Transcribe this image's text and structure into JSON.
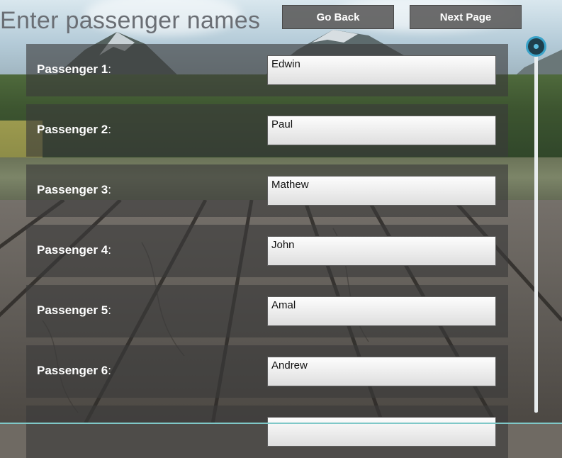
{
  "header": {
    "title": "Enter passenger names",
    "back_button": "Go Back",
    "next_button": "Next Page"
  },
  "passengers": [
    {
      "label": "Passenger 1",
      "value": "Edwin"
    },
    {
      "label": "Passenger 2",
      "value": "Paul"
    },
    {
      "label": "Passenger 3",
      "value": "Mathew"
    },
    {
      "label": "Passenger 4",
      "value": "John"
    },
    {
      "label": "Passenger 5",
      "value": "Amal"
    },
    {
      "label": "Passenger 6",
      "value": "Andrew"
    },
    {
      "label": "",
      "value": ""
    }
  ],
  "colors": {
    "button_bg": "#5f5f5f",
    "row_overlay": "#3a3a3a",
    "scroll_accent": "#3aa3c9",
    "title_color": "#6a6e74"
  },
  "icons": [
    "scroll-thumb-icon"
  ]
}
